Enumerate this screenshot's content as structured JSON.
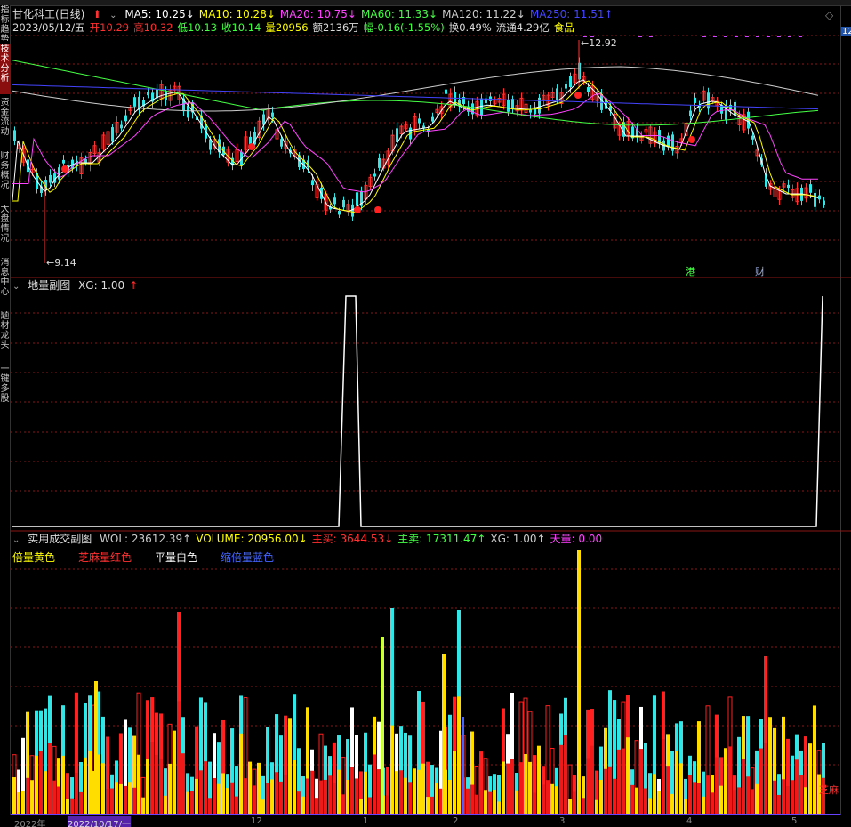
{
  "sidebar": {
    "items": [
      {
        "label": "指标趋势",
        "active": false
      },
      {
        "label": "技术分析",
        "active": true
      },
      {
        "label": "资金流动",
        "active": false
      },
      {
        "label": "财务概况",
        "active": false
      },
      {
        "label": "大盘情况",
        "active": false
      },
      {
        "label": "消息中心",
        "active": false
      },
      {
        "label": "题材龙头",
        "active": false
      },
      {
        "label": "一键多股",
        "active": false
      }
    ]
  },
  "main_chart": {
    "title": "甘化科工(日线)",
    "ma": [
      {
        "label": "MA5: 10.25",
        "color": "#ffffff"
      },
      {
        "label": "MA10: 10.28",
        "color": "#ffff00"
      },
      {
        "label": "MA20: 10.75",
        "color": "#ff44ff"
      },
      {
        "label": "MA60: 11.33",
        "color": "#44ff44"
      },
      {
        "label": "MA120: 11.22",
        "color": "#cccccc"
      },
      {
        "label": "MA250: 11.51",
        "color": "#4444ff"
      }
    ],
    "ma_arrows": [
      "↓",
      "↓",
      "↓",
      "↓",
      "↓",
      "↑"
    ],
    "info_line": {
      "date": "2023/05/12/五",
      "open": "开10.29",
      "high": "高10.32",
      "low": "低10.13",
      "close": "收10.14",
      "volume": "量20956",
      "amount": "额2136万",
      "change": "幅-0.16(-1.55%)",
      "turnover": "换0.49%",
      "float": "流通4.29亿",
      "sector": "食品"
    },
    "high_label": "12.92",
    "low_label": "9.14",
    "tag_hk": "港",
    "tag_fin": "财",
    "right_price": "12"
  },
  "sub_chart1": {
    "title": "地量副图",
    "xg": "XG: 1.00"
  },
  "sub_chart2": {
    "title": "实用成交副图",
    "values": [
      {
        "label": "WOL: 23612.39",
        "color": "#cccccc",
        "arrow": "↑"
      },
      {
        "label": "VOLUME: 20956.00",
        "color": "#ffff00",
        "arrow": "↓"
      },
      {
        "label": "主买: 3644.53",
        "color": "#ff3333",
        "arrow": "↓"
      },
      {
        "label": "主卖: 17311.47",
        "color": "#44ff44",
        "arrow": "↑"
      },
      {
        "label": "XG: 1.00",
        "color": "#cccccc",
        "arrow": "↑"
      },
      {
        "label": "天量: 0.00",
        "color": "#ff44ff",
        "arrow": ""
      }
    ],
    "legend": [
      {
        "label": "倍量黄色",
        "color": "#ffff00"
      },
      {
        "label": "芝麻量红色",
        "color": "#ff3333"
      },
      {
        "label": "平量白色",
        "color": "#ffffff"
      },
      {
        "label": "缩倍量蓝色",
        "color": "#4466ff"
      }
    ],
    "corner_label": "芝麻"
  },
  "bottom_axis": {
    "labels": [
      "2022年",
      "2022/10/17/一",
      "12",
      "1",
      "2",
      "3",
      "4",
      "5"
    ]
  },
  "colors": {
    "up": "#ff3030",
    "down": "#33e5e5",
    "grid": "#8a1414"
  }
}
